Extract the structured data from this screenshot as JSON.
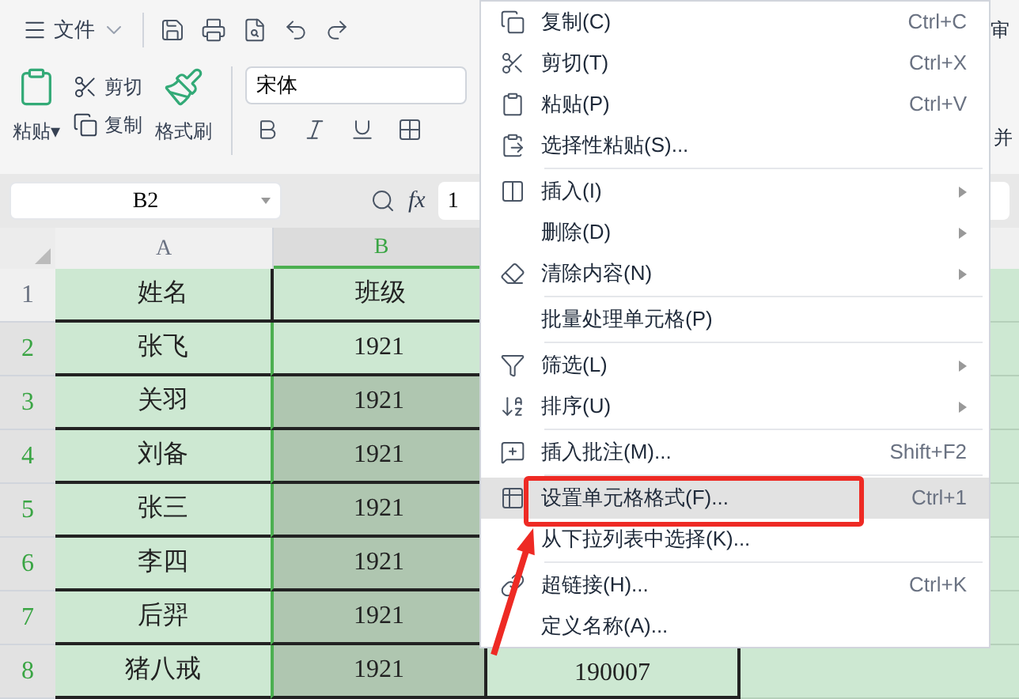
{
  "toolbar": {
    "file_menu": "文件"
  },
  "ribbon": {
    "paste": "粘贴",
    "paste_caret": "▾",
    "cut": "剪切",
    "copy": "复制",
    "format_painter": "格式刷",
    "font": "宋体",
    "right_tab": "审",
    "right_button": "并"
  },
  "formula_bar": {
    "name_box": "B2",
    "fx": "fx",
    "value": "1"
  },
  "sheet": {
    "columns": [
      {
        "label": "A",
        "selected": false
      },
      {
        "label": "B",
        "selected": true
      }
    ],
    "rows": [
      {
        "number": "1",
        "selected": false,
        "cells": [
          {
            "text": "姓名",
            "selected": false
          },
          {
            "text": "班级",
            "selected": false
          }
        ]
      },
      {
        "number": "2",
        "selected": true,
        "cells": [
          {
            "text": "张飞",
            "selected": false
          },
          {
            "text": "1921",
            "selected": false
          }
        ]
      },
      {
        "number": "3",
        "selected": true,
        "cells": [
          {
            "text": "关羽",
            "selected": false
          },
          {
            "text": "1921",
            "selected": true
          }
        ]
      },
      {
        "number": "4",
        "selected": true,
        "cells": [
          {
            "text": "刘备",
            "selected": false
          },
          {
            "text": "1921",
            "selected": true
          }
        ]
      },
      {
        "number": "5",
        "selected": true,
        "cells": [
          {
            "text": "张三",
            "selected": false
          },
          {
            "text": "1921",
            "selected": true
          }
        ]
      },
      {
        "number": "6",
        "selected": true,
        "cells": [
          {
            "text": "李四",
            "selected": false
          },
          {
            "text": "1921",
            "selected": true
          }
        ]
      },
      {
        "number": "7",
        "selected": true,
        "cells": [
          {
            "text": "后羿",
            "selected": false
          },
          {
            "text": "1921",
            "selected": true
          }
        ]
      },
      {
        "number": "8",
        "selected": true,
        "cells": [
          {
            "text": "猪八戒",
            "selected": false
          },
          {
            "text": "1921",
            "selected": true
          }
        ],
        "column_3": "190007"
      }
    ]
  },
  "context_menu": [
    {
      "kind": "item",
      "label": "复制(C)",
      "shortcut": "Ctrl+C",
      "submenu": false,
      "selected": false
    },
    {
      "kind": "item",
      "label": "剪切(T)",
      "shortcut": "Ctrl+X",
      "submenu": false,
      "selected": false
    },
    {
      "kind": "item",
      "label": "粘贴(P)",
      "shortcut": "Ctrl+V",
      "submenu": false,
      "selected": false
    },
    {
      "kind": "item",
      "label": "选择性粘贴(S)...",
      "submenu": false,
      "selected": false
    },
    {
      "kind": "separator"
    },
    {
      "kind": "item",
      "label": "插入(I)",
      "submenu": true,
      "selected": false
    },
    {
      "kind": "item",
      "label": "删除(D)",
      "submenu": true,
      "selected": false
    },
    {
      "kind": "item",
      "label": "清除内容(N)",
      "submenu": true,
      "selected": false
    },
    {
      "kind": "separator"
    },
    {
      "kind": "item",
      "label": "批量处理单元格(P)",
      "submenu": false,
      "selected": false
    },
    {
      "kind": "separator"
    },
    {
      "kind": "item",
      "label": "筛选(L)",
      "submenu": true,
      "selected": false
    },
    {
      "kind": "item",
      "label": "排序(U)",
      "submenu": true,
      "selected": false
    },
    {
      "kind": "separator"
    },
    {
      "kind": "item",
      "label": "插入批注(M)...",
      "shortcut": "Shift+F2",
      "submenu": false,
      "selected": false
    },
    {
      "kind": "separator"
    },
    {
      "kind": "item",
      "label": "设置单元格格式(F)...",
      "shortcut": "Ctrl+1",
      "submenu": false,
      "selected": true
    },
    {
      "kind": "item",
      "label": "从下拉列表中选择(K)...",
      "submenu": false,
      "selected": false
    },
    {
      "kind": "separator"
    },
    {
      "kind": "item",
      "label": "超链接(H)...",
      "shortcut": "Ctrl+K",
      "submenu": false,
      "selected": false
    },
    {
      "kind": "item",
      "label": "定义名称(A)...",
      "submenu": false,
      "selected": false
    }
  ]
}
